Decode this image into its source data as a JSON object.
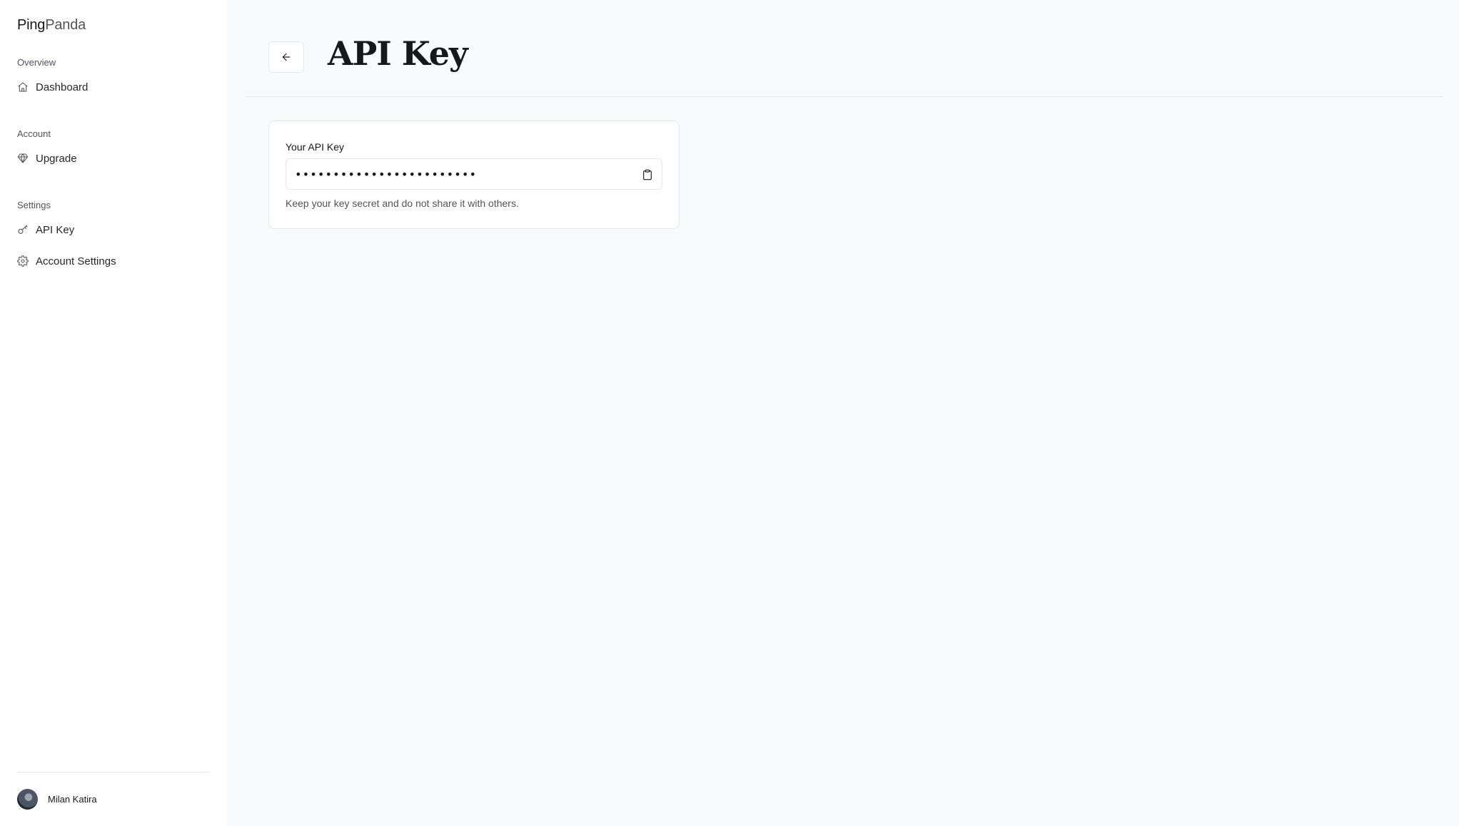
{
  "brand": {
    "part1": "Ping",
    "part2": "Panda"
  },
  "sidebar": {
    "sections": [
      {
        "label": "Overview",
        "items": [
          {
            "label": "Dashboard",
            "icon": "home-icon"
          }
        ]
      },
      {
        "label": "Account",
        "items": [
          {
            "label": "Upgrade",
            "icon": "gem-icon"
          }
        ]
      },
      {
        "label": "Settings",
        "items": [
          {
            "label": "API Key",
            "icon": "key-icon"
          },
          {
            "label": "Account Settings",
            "icon": "gear-icon"
          }
        ]
      }
    ],
    "user": {
      "name": "Milan Katira"
    }
  },
  "header": {
    "title": "API Key",
    "back_icon": "arrow-left-icon"
  },
  "card": {
    "label": "Your API Key",
    "masked_value": "••••••••••••••••••••••••",
    "copy_icon": "clipboard-icon",
    "hint": "Keep your key secret and do not share it with others."
  },
  "colors": {
    "sidebar_bg": "#ffffff",
    "main_bg": "#f9fafb",
    "border": "#e5e7eb",
    "text": "#18181b",
    "muted": "#52525b"
  }
}
